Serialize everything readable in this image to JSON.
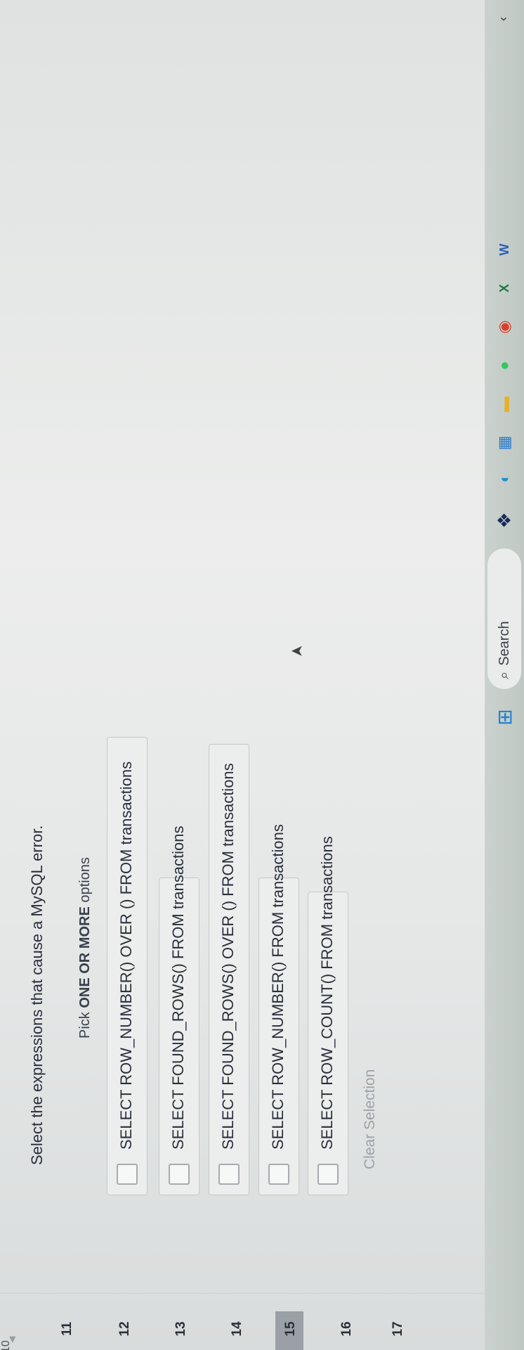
{
  "question": {
    "top_number": "10",
    "prompt": "Select the expressions that cause a MySQL error.",
    "instruction_prefix": "Pick ",
    "instruction_bold": "ONE OR MORE",
    "instruction_suffix": " options",
    "options": [
      {
        "label": "SELECT ROW_NUMBER() OVER () FROM transactions",
        "checked": false
      },
      {
        "label": "SELECT FOUND_ROWS() FROM transactions",
        "checked": false
      },
      {
        "label": "SELECT FOUND_ROWS() OVER () FROM transactions",
        "checked": false
      },
      {
        "label": "SELECT ROW_NUMBER() FROM transactions",
        "checked": false
      },
      {
        "label": "SELECT ROW_COUNT() FROM transactions",
        "checked": false
      }
    ],
    "clear_label": "Clear Selection"
  },
  "rail": {
    "numbers": [
      "11",
      "12",
      "13",
      "14",
      "15",
      "16",
      "17"
    ],
    "active_number": "14"
  },
  "taskbar": {
    "search_label": "Search",
    "apps": [
      "windows-icon",
      "task-view-icon",
      "edge-icon",
      "store-icon",
      "explorer-icon",
      "spotify-icon",
      "chrome-icon",
      "excel-icon",
      "word-icon"
    ],
    "excel_glyph": "X",
    "word_glyph": "W"
  }
}
